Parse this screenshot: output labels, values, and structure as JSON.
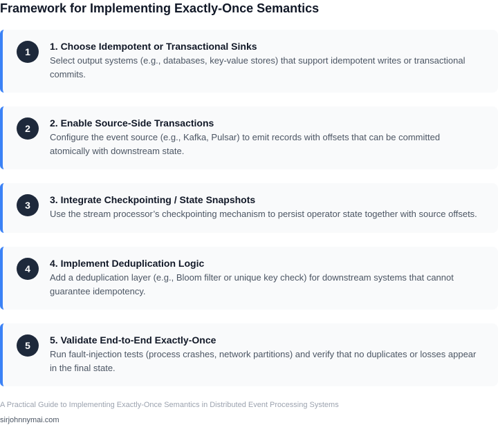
{
  "title": "Framework for Implementing Exactly-Once Semantics",
  "steps": [
    {
      "number": "1",
      "title": "1. Choose Idempotent or Transactional Sinks",
      "description": "Select output systems (e.g., databases, key-value stores) that support idempotent writes or transactional commits."
    },
    {
      "number": "2",
      "title": "2. Enable Source-Side Transactions",
      "description": "Configure the event source (e.g., Kafka, Pulsar) to emit records with offsets that can be committed atomically with downstream state."
    },
    {
      "number": "3",
      "title": "3. Integrate Checkpointing / State Snapshots",
      "description": "Use the stream processor’s checkpointing mechanism to persist operator state together with source offsets."
    },
    {
      "number": "4",
      "title": "4. Implement Deduplication Logic",
      "description": "Add a deduplication layer (e.g., Bloom filter or unique key check) for downstream systems that cannot guarantee idempotency."
    },
    {
      "number": "5",
      "title": "5. Validate End-to-End Exactly-Once",
      "description": "Run fault-injection tests (process crashes, network partitions) and verify that no duplicates or losses appear in the final state."
    }
  ],
  "footer": {
    "caption": "A Practical Guide to Implementing Exactly-Once Semantics in Distributed Event Processing Systems",
    "site": "sirjohnnymai.com"
  },
  "colors": {
    "accent": "#3b82f6",
    "badge": "#1e293b",
    "card_background": "#f9fafb"
  }
}
